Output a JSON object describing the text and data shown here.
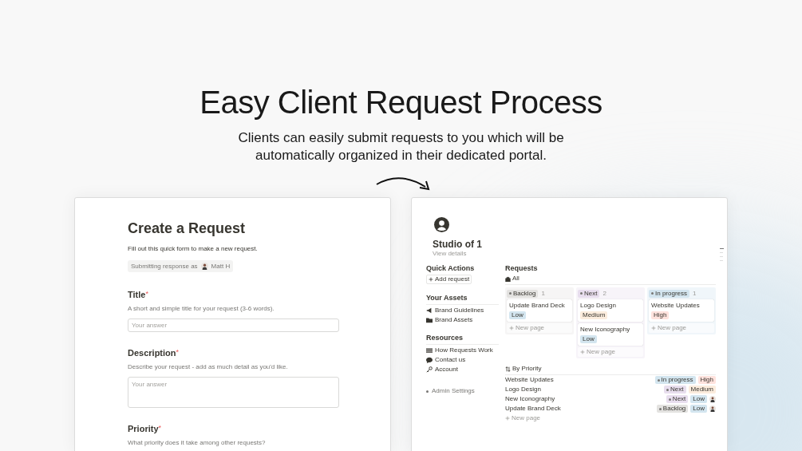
{
  "headline": "Easy Client Request Process",
  "subheadline": "Clients can easily submit requests to you which will be automatically organized in their dedicated portal.",
  "form": {
    "title": "Create a Request",
    "description": "Fill out this quick form to make a new request.",
    "respondent": {
      "prefix": "Submitting response as",
      "name": "Matt H"
    },
    "questions": [
      {
        "kind": "short",
        "label": "Title",
        "required_mark": "*",
        "help": "A short and simple title for your request (3-6 words).",
        "placeholder": "Your answer"
      },
      {
        "kind": "long",
        "label": "Description",
        "required_mark": "*",
        "help": "Describe your request - add as much detail as you'd like.",
        "placeholder": "Your answer"
      },
      {
        "kind": "choice",
        "label": "Priority",
        "required_mark": "*",
        "help": "What priority does it take among other requests?"
      }
    ]
  },
  "portal": {
    "title": "Studio of 1",
    "subtitle": "View details",
    "quick_actions": {
      "heading": "Quick Actions",
      "button": "Add request"
    },
    "sections": [
      {
        "heading": "Your Assets",
        "items": [
          {
            "kind": "megaphone",
            "label": "Brand Guidelines"
          },
          {
            "kind": "folder",
            "label": "Brand Assets"
          }
        ]
      },
      {
        "heading": "Resources",
        "items": [
          {
            "kind": "list",
            "label": "How Requests Work"
          },
          {
            "kind": "chat",
            "label": "Contact us"
          },
          {
            "kind": "key",
            "label": "Account"
          }
        ]
      }
    ],
    "admin_link": "Admin Settings",
    "requests": {
      "title": "Requests",
      "view": "All",
      "columns": [
        {
          "status": "Backlog",
          "count": "1",
          "color": "#e3e2e0",
          "new_page": "New page",
          "cards": [
            {
              "title": "Update Brand Deck",
              "priority": {
                "label": "Low",
                "color": "#d3e5ef"
              }
            }
          ]
        },
        {
          "status": "Next",
          "count": "2",
          "color": "#e8deee",
          "new_page": "New page",
          "cards": [
            {
              "title": "Logo Design",
              "priority": {
                "label": "Medium",
                "color": "#fbecdd"
              }
            },
            {
              "title": "New Iconography",
              "priority": {
                "label": "Low",
                "color": "#d3e5ef"
              }
            }
          ]
        },
        {
          "status": "In progress",
          "count": "1",
          "color": "#d3e5ef",
          "new_page": "New page",
          "cards": [
            {
              "title": "Website Updates",
              "priority": {
                "label": "High",
                "color": "#ffe2dd"
              }
            }
          ]
        }
      ],
      "list": {
        "view": "By Priority",
        "new_page": "New page",
        "rows": [
          {
            "title": "Website Updates",
            "status": {
              "label": "In progress",
              "color": "#d3e5ef"
            },
            "priority": {
              "label": "High",
              "color": "#ffe2dd"
            },
            "assigned": false
          },
          {
            "title": "Logo Design",
            "status": {
              "label": "Next",
              "color": "#e8deee"
            },
            "priority": {
              "label": "Medium",
              "color": "#fbecdd"
            },
            "assigned": false
          },
          {
            "title": "New Iconography",
            "status": {
              "label": "Next",
              "color": "#e8deee"
            },
            "priority": {
              "label": "Low",
              "color": "#d3e5ef"
            },
            "assigned": true
          },
          {
            "title": "Update Brand Deck",
            "status": {
              "label": "Backlog",
              "color": "#e3e2e0"
            },
            "priority": {
              "label": "Low",
              "color": "#d3e5ef"
            },
            "assigned": true
          }
        ]
      }
    }
  }
}
